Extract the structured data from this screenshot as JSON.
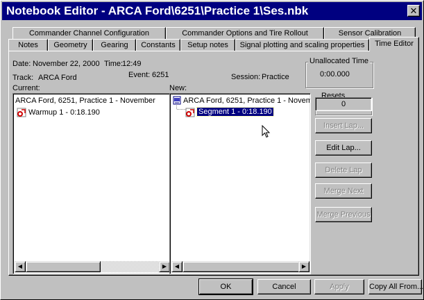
{
  "window": {
    "title": "Notebook Editor - ARCA Ford\\6251\\Practice 1\\Ses.nbk",
    "close_glyph": "✕"
  },
  "tabs": {
    "row1": [
      "Commander Channel Configuration",
      "Commander Options and Tire Rollout",
      "Sensor Calibration"
    ],
    "row2": [
      "Notes",
      "Geometry",
      "Gearing",
      "Constants",
      "Setup notes",
      "Signal plotting and scaling properties",
      "Time Editor"
    ],
    "active": "Time Editor"
  },
  "info": {
    "date_label": "Date:",
    "date": "November 22, 2000",
    "time_label": "Time:",
    "time": "12:49",
    "track_label": "Track:",
    "track": "ARCA Ford",
    "event_label": "Event:",
    "event": "6251",
    "session_label": "Session:",
    "session": "Practice"
  },
  "current": {
    "label": "Current:",
    "root": "ARCA Ford, 6251, Practice 1 - November",
    "child": "Warmup 1 - 0:18.190"
  },
  "new": {
    "label": "New:",
    "root": "ARCA Ford, 6251, Practice 1 - Novem",
    "child": "Segment 1 - 0:18.190"
  },
  "unallocated": {
    "title": "Unallocated Time",
    "value": "0:00.000"
  },
  "resets": {
    "title": "Resets",
    "value": "0"
  },
  "side_buttons": {
    "insert_lap": "Insert Lap...",
    "edit_lap": "Edit Lap...",
    "delete_lap": "Delete Lap",
    "merge_next": "Merge Next",
    "merge_previous": "Merge Previous"
  },
  "footer": {
    "ok": "OK",
    "cancel": "Cancel",
    "apply": "Apply",
    "copy_all": "Copy All From..."
  },
  "colors": {
    "titlebar": "#000080",
    "face": "#c0c0c0",
    "selection": "#000080",
    "lap_icon": "#d00000"
  }
}
